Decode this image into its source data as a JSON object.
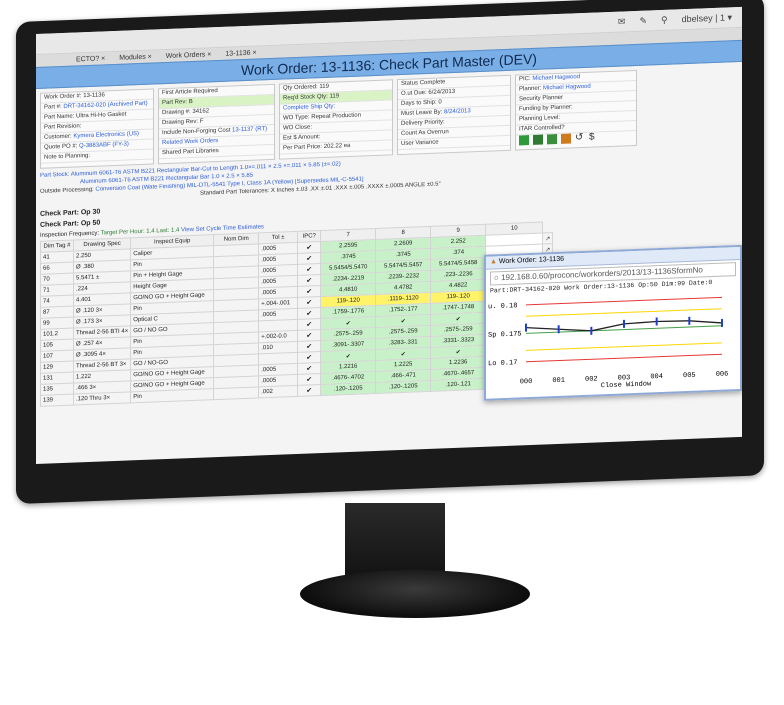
{
  "header": {
    "title": "Work Order: 13-1136: Check Part Master (DEV)",
    "user": "dbelsey | 1 ▾",
    "tabs": [
      "ECTO? ×",
      "Modules ×",
      "Work Orders ×",
      "13-1136 ×"
    ]
  },
  "info1": {
    "wo": "13-1136",
    "wo_label": "Work Order #:",
    "part_label": "Part #:",
    "part": "DRT-34162-020 (Archived Part)",
    "partname_label": "Part Name:",
    "partname": "Ultra Hi-Ho Gasket",
    "rev_label": "Part Revision:",
    "cust_label": "Customer:",
    "cust": "Kymera Electronics (US)",
    "quote_label": "Quote PO #:",
    "quote": "Q-3883ABF (FY-3)",
    "notes_label": "Note to Planning:"
  },
  "info2": {
    "first": "First Article Required",
    "rev_label": "Part Rev:",
    "rev": "B",
    "drawing_label": "Drawing #:",
    "drawing": "34162",
    "drawrev_label": "Drawing Rev:",
    "drawrev": "F",
    "nonforging": "Include Non-Forging Cost",
    "related": "Related Work Orders",
    "related_val": "13-1137 (RT)",
    "shared": "Shared Part Libraries"
  },
  "info3": {
    "qty_label": "Qty Ordered:",
    "qty": "119",
    "req_label": "Req'd Stock Qty:",
    "req": "119",
    "complete": "Complete Ship Qty:",
    "wo_type": "WO Type:",
    "wo_type_val": "Repeat Production",
    "wo_close": "WO Close:",
    "est_label": "Est $ Amount:",
    "perpart_label": "Per Part Price:",
    "perpart": "202.22 ea"
  },
  "info4": {
    "status_label": "Status",
    "status": "Complete",
    "ot_label": "O.ut Due:",
    "ot": "6/24/2013",
    "days_label": "Days to Ship:",
    "days": "0",
    "must_label": "Must Leave By:",
    "must": "8/24/2013",
    "delivery_label": "Delivery Priority:",
    "countas": "Count As Overrun",
    "user_label": "User Variance"
  },
  "info5": {
    "pic_label": "PIC:",
    "pic": "Michael Hagwood",
    "planner_label": "Planner:",
    "planner": "Michael Hagwood",
    "sec": "Security Planner",
    "funding": "Funding by Planner:",
    "planning": "Planning Level:",
    "itar": "ITAR Controlled?"
  },
  "notes": {
    "part_stock_label": "Part Stock:",
    "part_stock": "Aluminum 6061-T6 ASTM B221 Rectangular Bar-Cut to Length 1.0×=.011 × 2.5 ×=.011 × 5.85 (±=.02)",
    "part_stock2": "Aluminum 6061-T6 ASTM B221 Rectangular Bar 1.0 × 2.5 × 5.85",
    "outside_label": "Outside Processing:",
    "outside": "Conversion Coat (Wate Finishing) MIL-DTL-5541 Type I, Class 1A (Yellow) [Supersedes MIL-C-5541]",
    "tol": "Standard Part Tolerances:   X Inches ±.03   .XX ±.01   .XXX ±.005   .XXXX ±.0005   ANGLE ±0.5°"
  },
  "grid": {
    "sec1": "Check Part: Op 30",
    "sec2": "Check Part: Op 50",
    "freq": "Inspection Frequency:",
    "target": "Target Per Hour: 1.4  Last: 1.4",
    "view": "View Set Cycle Time Estimates",
    "cols": [
      "Dim Tag #",
      "Drawing Spec",
      "Inspect Equip",
      "Nom Dim",
      "Tol ±",
      "IPC?",
      "7",
      "8",
      "9",
      "10"
    ],
    "rows": [
      {
        "tag": "41",
        "spec": "2.250",
        "eq": "Caliper",
        "nom": "",
        "tol": ".0005",
        "c7": "2.2595",
        "c8": "2.2609",
        "c9": "2.252",
        "t": "g"
      },
      {
        "tag": "66",
        "spec": "Ø .380",
        "eq": "Pin",
        "nom": "",
        "tol": ".0005",
        "c7": ".3745",
        "c8": ".3745",
        "c9": ".374",
        "t": "g"
      },
      {
        "tag": "70",
        "spec": "5.5471 ±",
        "eq": "Pin + Height Gage",
        "nom": "",
        "tol": ".0005",
        "c7": "5.5454/5.5470",
        "c8": "5.5474/5.5457",
        "c9": "5.5474/5.5458",
        "t": "g"
      },
      {
        "tag": "71",
        "spec": ".224",
        "eq": "Height Gage",
        "nom": "",
        "tol": ".0005",
        "c7": ".2234-.2219",
        "c8": ".2239-.2232",
        "c9": ".223-.2236",
        "t": "g"
      },
      {
        "tag": "74",
        "spec": "4.401",
        "eq": "GO/NO GO + Height Gage",
        "nom": "",
        "tol": ".0005",
        "c7": "4.4810",
        "c8": "4.4782",
        "c9": "4.4822",
        "t": "g"
      },
      {
        "tag": "87",
        "spec": "Ø .120  3×",
        "eq": "Pin",
        "nom": "",
        "tol": "+.004-.001",
        "c7": "119-.120",
        "c8": ".1119-.1120",
        "c9": "119-.120",
        "t": "y"
      },
      {
        "tag": "99",
        "spec": "Ø .173  3×",
        "eq": "Optical C",
        "nom": "",
        "tol": ".0005",
        "c7": ".1759-.1776",
        "c8": ".1752-.177",
        "c9": ".1747-.1748",
        "t": "g"
      },
      {
        "tag": "101.2",
        "spec": "Thread 2-56 BTI  4×",
        "eq": "GO / NO GO",
        "nom": "",
        "tol": "",
        "c7": "✔",
        "c8": "✔",
        "c9": "✔",
        "t": "g"
      },
      {
        "tag": "105",
        "spec": "Ø .257  4×",
        "eq": "Pin",
        "nom": "",
        "tol": "+.002-0.0",
        "c7": ".2575-.259",
        "c8": ".2575-.259",
        "c9": ".2575-.259",
        "t": "g"
      },
      {
        "tag": "107",
        "spec": "Ø .3095  4×",
        "eq": "Pin",
        "nom": "",
        "tol": ".010",
        "c7": ".3091-.3307",
        "c8": ".3283-.331",
        "c9": ".3331-.3323",
        "t": "g"
      },
      {
        "tag": "129",
        "spec": "Thread 2-56 BT  3×",
        "eq": "GO / NO-GO",
        "nom": "",
        "tol": "",
        "c7": "✔",
        "c8": "✔",
        "c9": "✔",
        "t": "g"
      },
      {
        "tag": "131",
        "spec": "1.222",
        "eq": "GO/NO GO + Height Gage",
        "nom": "",
        "tol": ".0005",
        "c7": "1.2216",
        "c8": "1.2225",
        "c9": "1.2236",
        "t": "g"
      },
      {
        "tag": "135",
        "spec": ".466  3×",
        "eq": "GO/NO GO + Height Gage",
        "nom": "",
        "tol": ".0005",
        "c7": ".4676-.4702",
        "c8": ".466-.471",
        "c9": ".4670-.4657",
        "t": "g"
      },
      {
        "tag": "139",
        "spec": ".120  Thru  3×",
        "eq": "Pin",
        "nom": "",
        "tol": ".002",
        "c7": ".120-.1205",
        "c8": ".120-.1205",
        "c9": ".120-.121",
        "t": "g"
      }
    ],
    "go_label": "Go/NoGo"
  },
  "popup": {
    "title": "Work Order: 13-1136",
    "url": "192.168.0.60/proconc/workorders/2013/13-1136SformNo",
    "caption": "Part:DRT-34162-020  Work Order:13-1136  Op:50  Dim:99  Date:0",
    "u": "u. 0.18",
    "sp": "Sp 0.175",
    "lo": "Lo 0.17",
    "xt": [
      "000",
      "001",
      "002",
      "003",
      "004",
      "005",
      "006"
    ],
    "close": "Close Window"
  },
  "chart_data": {
    "type": "line",
    "x": [
      "000",
      "001",
      "002",
      "003",
      "004",
      "005",
      "006"
    ],
    "series": [
      {
        "values": [
          0.176,
          0.1755,
          0.175,
          0.176,
          0.1762,
          0.1761,
          0.1755
        ]
      }
    ],
    "ylim": [
      0.168,
      0.181
    ],
    "limits": {
      "upper": 0.18,
      "setpoint": 0.175,
      "lower": 0.17
    }
  }
}
